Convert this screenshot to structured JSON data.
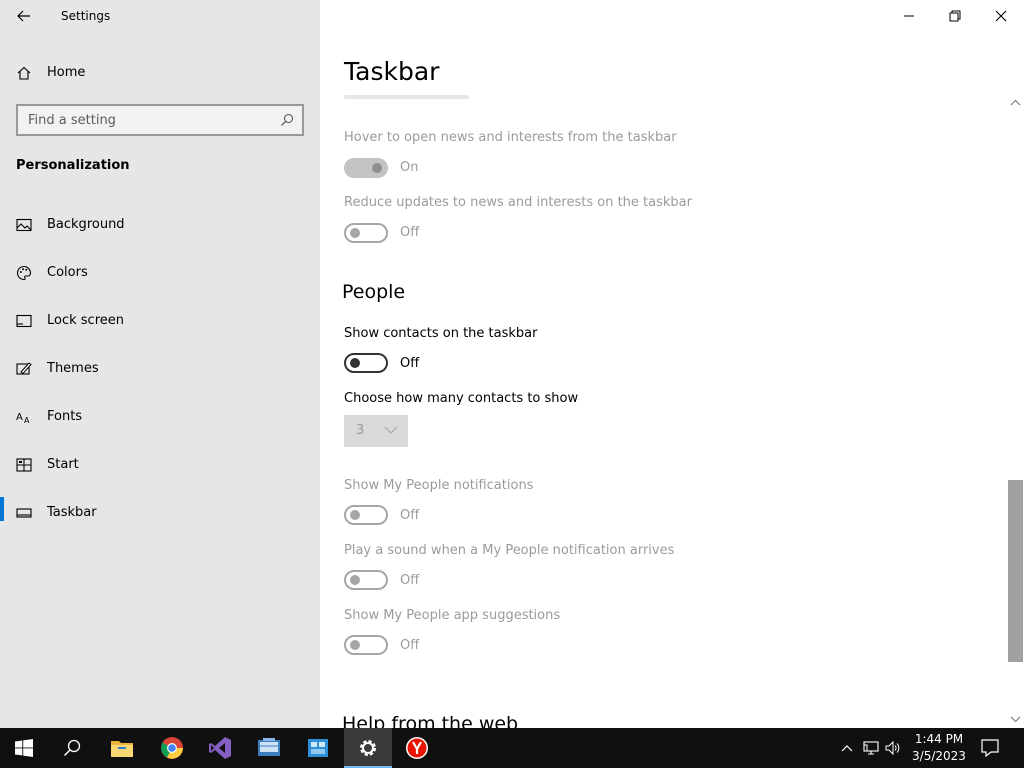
{
  "window": {
    "title": "Settings"
  },
  "sidebar": {
    "home_label": "Home",
    "search_placeholder": "Find a setting",
    "section_title": "Personalization",
    "items": [
      {
        "label": "Background",
        "icon": "picture-icon"
      },
      {
        "label": "Colors",
        "icon": "palette-icon"
      },
      {
        "label": "Lock screen",
        "icon": "lock-screen-icon"
      },
      {
        "label": "Themes",
        "icon": "themes-icon"
      },
      {
        "label": "Fonts",
        "icon": "fonts-icon"
      },
      {
        "label": "Start",
        "icon": "start-icon"
      },
      {
        "label": "Taskbar",
        "icon": "taskbar-icon",
        "active": true
      }
    ]
  },
  "main": {
    "page_title": "Taskbar",
    "news_settings": [
      {
        "label": "Hover to open news and interests from the taskbar",
        "state": "On",
        "enabled": false
      },
      {
        "label": "Reduce updates to news and interests on the taskbar",
        "state": "Off",
        "enabled": false
      }
    ],
    "people_heading": "People",
    "show_contacts": {
      "label": "Show contacts on the taskbar",
      "state": "Off",
      "enabled": true
    },
    "contacts_count": {
      "label": "Choose how many contacts to show",
      "value": "3",
      "enabled": false
    },
    "people_settings": [
      {
        "label": "Show My People notifications",
        "state": "Off",
        "enabled": false
      },
      {
        "label": "Play a sound when a My People notification arrives",
        "state": "Off",
        "enabled": false
      },
      {
        "label": "Show My People app suggestions",
        "state": "Off",
        "enabled": false
      }
    ],
    "help_heading": "Help from the web"
  },
  "taskbar": {
    "time": "1:44 PM",
    "date": "3/5/2023",
    "apps": [
      "start-icon",
      "search-icon",
      "file-explorer-icon",
      "chrome-icon",
      "visual-studio-icon",
      "app-icon",
      "app-icon-2",
      "settings-icon",
      "yandex-icon"
    ]
  },
  "colors": {
    "accent": "#0078d7",
    "sidebar_bg": "#e6e6e6",
    "taskbar_bg": "#101010"
  }
}
